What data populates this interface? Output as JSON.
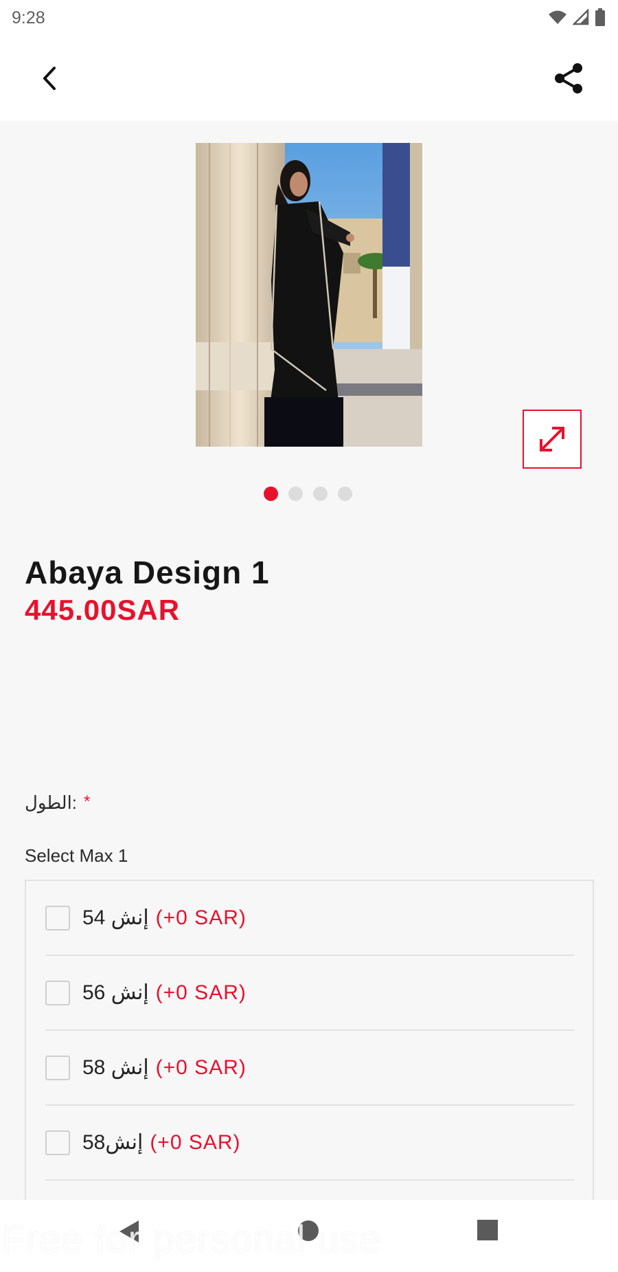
{
  "status_bar": {
    "time": "9:28",
    "icons": [
      "wifi-icon",
      "signal-icon",
      "battery-icon"
    ]
  },
  "app_bar": {
    "back_icon": "chevron-left-icon",
    "share_icon": "share-icon"
  },
  "gallery": {
    "image_alt": "Woman wearing black abaya leaning on a pillar",
    "expand_icon": "expand-arrows-icon",
    "dot_count": 4,
    "active_dot": 0
  },
  "product": {
    "name": "Abaya Design 1",
    "price": "445.00SAR"
  },
  "option_group": {
    "required_mark": "*",
    "label": "الطول:",
    "select_max": "Select Max 1",
    "options": [
      {
        "label": "54 إنش",
        "price": "(+0 SAR)"
      },
      {
        "label": "56 إنش",
        "price": "(+0 SAR)"
      },
      {
        "label": "58 إنش",
        "price": "(+0 SAR)"
      },
      {
        "label": "58إنش",
        "price": "(+0 SAR)"
      }
    ]
  },
  "nav_bar": {
    "back_icon": "triangle-back-icon",
    "home_icon": "circle-home-icon",
    "recents_icon": "square-recents-icon"
  },
  "watermark": "Free for personal use",
  "colors": {
    "accent": "#e8112d",
    "background": "#f7f7f7",
    "surface": "#ffffff",
    "border": "#e2e2e2"
  }
}
